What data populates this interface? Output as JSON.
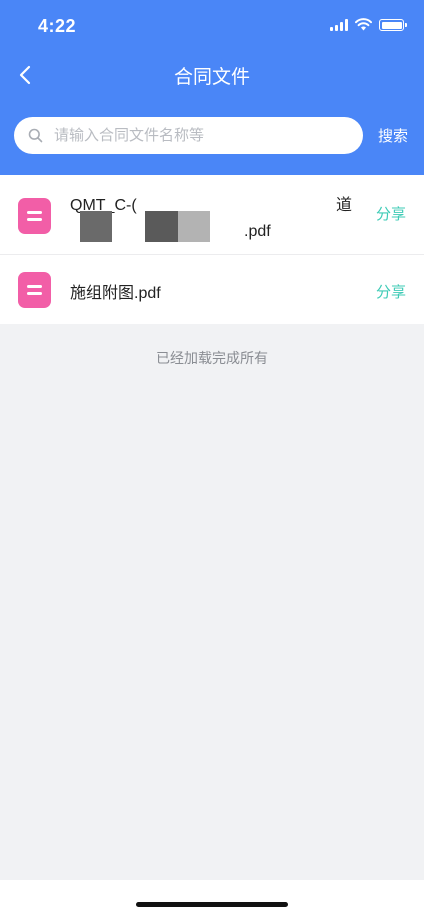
{
  "status_bar": {
    "time": "4:22"
  },
  "header": {
    "title": "合同文件"
  },
  "search": {
    "placeholder": "请输入合同文件名称等",
    "button_label": "搜索"
  },
  "files": [
    {
      "line1": "QMT_C-(",
      "line1_tail": "道",
      "line2": ".pdf",
      "share_label": "分享"
    },
    {
      "name": "施组附图.pdf",
      "share_label": "分享"
    }
  ],
  "footer_note": "已经加载完成所有",
  "colors": {
    "header": "#4a86f7",
    "accent": "#3ecbb6",
    "file_icon": "#f25ea7",
    "background": "#f1f2f4"
  }
}
